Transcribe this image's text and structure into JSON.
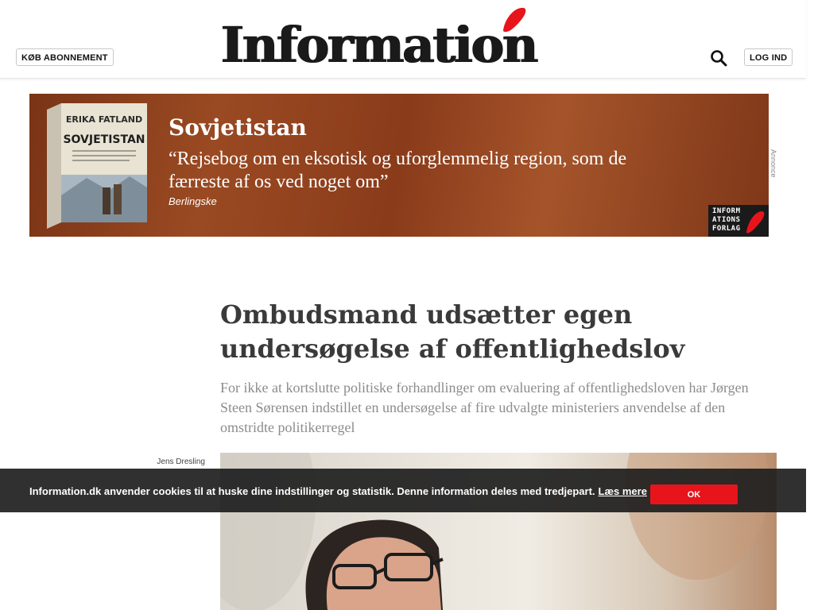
{
  "header": {
    "subscribe_label": "KØB ABONNEMENT",
    "logo_text": "Information",
    "login_label": "LOG IND"
  },
  "ad": {
    "book_author": "ERIKA FATLAND",
    "book_title": "SOVJETISTAN",
    "title": "Sovjetistan",
    "quote": "“Rejsebog om en eksotisk og uforglemmelig region, som de færreste af os ved noget om”",
    "source": "Berlingske",
    "publisher": "INFORM ATIONS FORLAG",
    "label": "Annonce"
  },
  "article": {
    "headline": "Ombudsmand udsætter egen undersøgelse af offentlighedslov",
    "lead": "For ikke at kortslutte politiske forhandlinger om evaluering af offentlighedsloven har Jørgen Steen Sørensen indstillet en undersøgelse af fire udvalgte ministeriers anvendelse af den omstridte politikerregel",
    "photo_credit": "Jens Dresling"
  },
  "cookie": {
    "text": "Information.dk anvender cookies til at huske dine indstillinger og statistik. Denne information deles med tredjepart.",
    "link_label": "Læs mere",
    "ok_label": "OK"
  },
  "colors": {
    "accent": "#e8141c",
    "ad_background": "#8a3b1a",
    "text_dark": "#3a3a3a",
    "text_muted": "#8c8c8c"
  }
}
